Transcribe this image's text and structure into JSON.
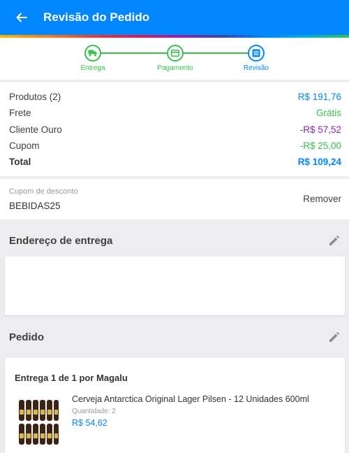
{
  "header": {
    "title": "Revisão do Pedido"
  },
  "steps": [
    {
      "label": "Entrega",
      "state": "done",
      "icon": "truck-icon"
    },
    {
      "label": "Pagamento",
      "state": "done",
      "icon": "card-icon"
    },
    {
      "label": "Revisão",
      "state": "active",
      "icon": "list-icon"
    }
  ],
  "summary": {
    "products_label": "Produtos (2)",
    "products_value": "R$ 191,76",
    "freight_label": "Frete",
    "freight_value": "Grátis",
    "gold_label": "Cliente Ouro",
    "gold_value": "-R$ 57,52",
    "coupon_label": "Cupom",
    "coupon_value": "-R$ 25,00",
    "total_label": "Total",
    "total_value": "R$ 109,24"
  },
  "coupon": {
    "caption": "Cupom de desconto",
    "code": "BEBIDAS25",
    "remove_label": "Remover"
  },
  "address": {
    "title": "Endereço de entrega"
  },
  "order": {
    "title": "Pedido",
    "delivery_title": "Entrega 1 de 1 por Magalu",
    "product": {
      "name": "Cerveja Antarctica Original Lager Pilsen - 12 Unidades 600ml",
      "quantity": "Quantidade:  2",
      "price": "R$ 54,62"
    }
  },
  "colors": {
    "primary": "#0086ff",
    "success": "#37c14b",
    "discount": "#8e24aa"
  }
}
